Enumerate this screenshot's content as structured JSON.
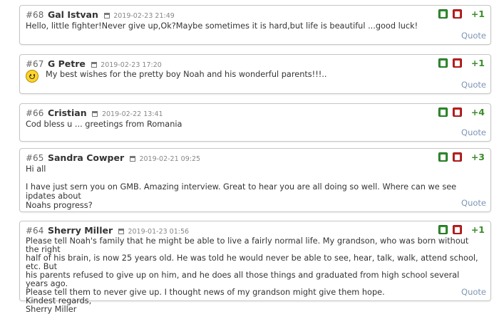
{
  "comments": [
    {
      "number": "#68",
      "author": "Gal Istvan",
      "date": "2019-02-23 21:49",
      "score": "+1",
      "lines": [
        "Hello, little fighter!Never give up,Ok?Maybe sometimes it is hard,but life is beautiful ...good luck!"
      ],
      "quote_label": "Quote"
    },
    {
      "number": "#67",
      "author": "G Petre",
      "date": "2019-02-23 17:20",
      "score": "+1",
      "emoticon": "smiley-icon",
      "lines": [
        "My best wishes for the pretty boy Noah and his wonderful parents!!!.."
      ],
      "quote_label": "Quote"
    },
    {
      "number": "#66",
      "author": "Cristian",
      "date": "2019-02-22 13:41",
      "score": "+4",
      "lines": [
        "Cod bless u ... greetings from Romania"
      ],
      "quote_label": "Quote"
    },
    {
      "number": "#65",
      "author": "Sandra Cowper",
      "date": "2019-02-21 09:25",
      "score": "+3",
      "lines": [
        "Hi all",
        "",
        "I have just sern you on GMB. Amazing interview. Great to hear you are all doing so well. Where can we see ipdates about",
        "Noahs progress?"
      ],
      "quote_label": "Quote"
    },
    {
      "number": "#64",
      "author": "Sherry Miller",
      "date": "2019-01-23 01:56",
      "score": "+1",
      "lines": [
        "Please tell Noah's family that he might be able to live a fairly normal life. My grandson, who was born without the right",
        "half of his brain, is now 25 years old. He was told he would never be able to see, hear, talk, walk, attend school, etc. But",
        "his parents refused to give up on him, and he does all those things and graduated from high school several years ago.",
        "Please tell them to never give up. I thought news of my grandson might give them hope.",
        "Kindest regards,",
        "Sherry Miller"
      ],
      "quote_label": "Quote"
    }
  ],
  "colors": {
    "score": "#3c8c2b",
    "quote": "#7d95b4",
    "upvote": "#2f8f2f",
    "downvote": "#c62020",
    "border": "#c6c6c6"
  },
  "icons": {
    "date": "calendar-icon",
    "upvote": "thumbs-up-icon",
    "downvote": "thumbs-down-icon"
  }
}
